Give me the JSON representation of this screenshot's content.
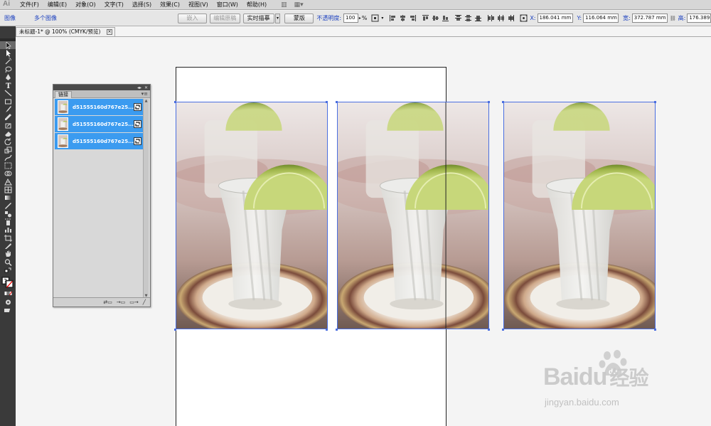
{
  "app": {
    "logo": "Ai"
  },
  "menu": [
    "文件(F)",
    "编辑(E)",
    "对象(O)",
    "文字(T)",
    "选择(S)",
    "效果(C)",
    "视图(V)",
    "窗口(W)",
    "帮助(H)"
  ],
  "control_bar": {
    "type_label": "图像",
    "multi_label": "多个图像",
    "embed_button": "嵌入",
    "edit_original_button": "编辑原稿",
    "live_trace_button": "实时描摹",
    "mask_button": "蒙版",
    "opacity_label": "不透明度:",
    "opacity_value": "100",
    "opacity_unit": "%",
    "x_label": "X:",
    "x_value": "186.041 mm",
    "y_label": "Y:",
    "y_value": "116.064 mm",
    "w_label": "宽:",
    "w_value": "372.787 mm",
    "h_label": "高:",
    "h_value": "176.389"
  },
  "document_tab": {
    "title": "未标题-1* @ 100% (CMYK/预览)",
    "close": "×"
  },
  "links_panel": {
    "tab_label": "链接",
    "items": [
      {
        "name": "d51555160d767e25..."
      },
      {
        "name": "d51555160d767e25..."
      },
      {
        "name": "d51555160d767e25..."
      }
    ],
    "footer_icons": [
      "relink-icon",
      "goto-link-icon",
      "update-link-icon",
      "edit-original-icon"
    ]
  },
  "watermark": {
    "brand": "Baidu",
    "brand_cn": "经验",
    "url": "jingyan.baidu.com"
  },
  "colors": {
    "selection": "#4a6ee0",
    "panel_highlight": "#3b9bf0",
    "toolbar": "#3a3a3a"
  }
}
